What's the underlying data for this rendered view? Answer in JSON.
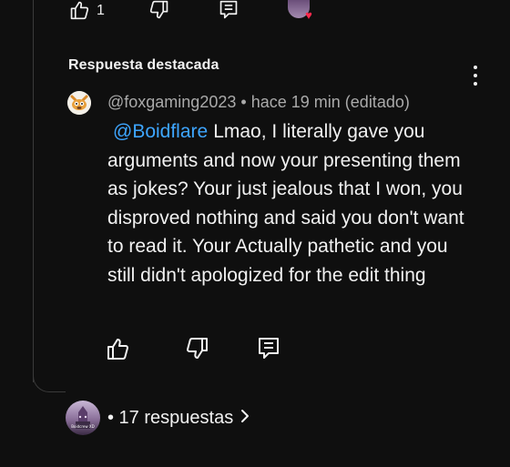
{
  "top_actions": {
    "like_count": "1",
    "icons": [
      "thumbs-up-icon",
      "thumbs-down-icon",
      "reply-icon",
      "creator-heart-icon"
    ]
  },
  "featured": {
    "label": "Respuesta destacada"
  },
  "comment": {
    "author": "@foxgaming2023",
    "separator": "•",
    "time": "hace 19 min",
    "edited": "(editado)",
    "mention": "@Boidflare",
    "text": "Lmao, I literally gave you arguments and now your presenting them as jokes? Your just jealous that I won, you disproved nothing and said you don't want to read it. Your Actually pathetic and you still didn't apologized for the edit thing"
  },
  "replies": {
    "label": "• 17 respuestas",
    "avatar_tag": "Boidcrew XD"
  },
  "colors": {
    "background": "#0f0f0f",
    "text": "#f1f1f1",
    "meta": "#aaaaaa",
    "mention": "#3ea6ff",
    "heart": "#ff2a4d"
  }
}
